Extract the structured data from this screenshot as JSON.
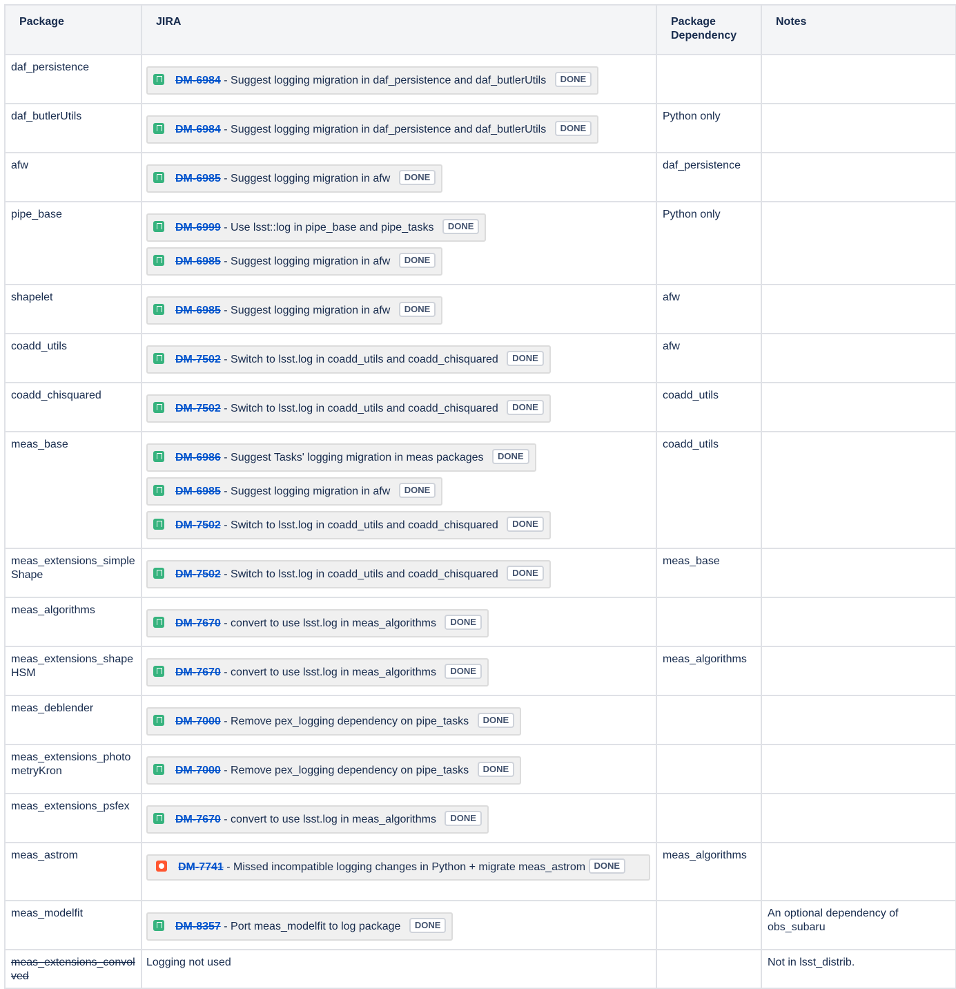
{
  "headers": {
    "package": "Package",
    "jira": "JIRA",
    "dependency": "Package Dependency",
    "notes": "Notes"
  },
  "rows": [
    {
      "package": "daf_persistence",
      "issues": [
        {
          "key": "DM-6984",
          "summary": "Suggest logging migration in daf_persistence and daf_butlerUtils",
          "status": "DONE",
          "type": "story"
        }
      ],
      "dependency": "",
      "notes": ""
    },
    {
      "package": "daf_butlerUtils",
      "issues": [
        {
          "key": "DM-6984",
          "summary": "Suggest logging migration in daf_persistence and daf_butlerUtils",
          "status": "DONE",
          "type": "story"
        }
      ],
      "dependency": "Python only",
      "notes": ""
    },
    {
      "package": "afw",
      "issues": [
        {
          "key": "DM-6985",
          "summary": "Suggest logging migration in afw",
          "status": "DONE",
          "type": "story"
        }
      ],
      "dependency": "daf_persistence",
      "notes": ""
    },
    {
      "package": "pipe_base",
      "issues": [
        {
          "key": "DM-6999",
          "summary": "Use lsst::log in pipe_base and pipe_tasks",
          "status": "DONE",
          "type": "story"
        },
        {
          "key": "DM-6985",
          "summary": "Suggest logging migration in afw",
          "status": "DONE",
          "type": "story"
        }
      ],
      "dependency": "Python only",
      "notes": ""
    },
    {
      "package": "shapelet",
      "issues": [
        {
          "key": "DM-6985",
          "summary": "Suggest logging migration in afw",
          "status": "DONE",
          "type": "story"
        }
      ],
      "dependency": "afw",
      "notes": ""
    },
    {
      "package": "coadd_utils",
      "issues": [
        {
          "key": "DM-7502",
          "summary": "Switch to lsst.log in coadd_utils and coadd_chisquared",
          "status": "DONE",
          "type": "story"
        }
      ],
      "dependency": "afw",
      "notes": ""
    },
    {
      "package": "coadd_chisquared",
      "issues": [
        {
          "key": "DM-7502",
          "summary": "Switch to lsst.log in coadd_utils and coadd_chisquared",
          "status": "DONE",
          "type": "story"
        }
      ],
      "dependency": "coadd_utils",
      "notes": ""
    },
    {
      "package": "meas_base",
      "issues": [
        {
          "key": "DM-6986",
          "summary": "Suggest Tasks' logging migration in meas packages",
          "status": "DONE",
          "type": "story"
        },
        {
          "key": "DM-6985",
          "summary": "Suggest logging migration in afw",
          "status": "DONE",
          "type": "story"
        },
        {
          "key": "DM-7502",
          "summary": "Switch to lsst.log in coadd_utils and coadd_chisquared",
          "status": "DONE",
          "type": "story"
        }
      ],
      "dependency": "coadd_utils",
      "notes": ""
    },
    {
      "package": "meas_extensions_simpleShape",
      "issues": [
        {
          "key": "DM-7502",
          "summary": "Switch to lsst.log in coadd_utils and coadd_chisquared",
          "status": "DONE",
          "type": "story"
        }
      ],
      "dependency": "meas_base",
      "notes": ""
    },
    {
      "package": "meas_algorithms",
      "issues": [
        {
          "key": "DM-7670",
          "summary": "convert to use lsst.log in meas_algorithms",
          "status": "DONE",
          "type": "story"
        }
      ],
      "dependency": "",
      "notes": ""
    },
    {
      "package": "meas_extensions_shapeHSM",
      "issues": [
        {
          "key": "DM-7670",
          "summary": "convert to use lsst.log in meas_algorithms",
          "status": "DONE",
          "type": "story"
        }
      ],
      "dependency": "meas_algorithms",
      "notes": ""
    },
    {
      "package": "meas_deblender",
      "issues": [
        {
          "key": "DM-7000",
          "summary": "Remove pex_logging dependency on pipe_tasks",
          "status": "DONE",
          "type": "story"
        }
      ],
      "dependency": "",
      "notes": ""
    },
    {
      "package": "meas_extensions_photometryKron",
      "issues": [
        {
          "key": "DM-7000",
          "summary": "Remove pex_logging dependency on pipe_tasks",
          "status": "DONE",
          "type": "story"
        }
      ],
      "dependency": "",
      "notes": ""
    },
    {
      "package": "meas_extensions_psfex",
      "issues": [
        {
          "key": "DM-7670",
          "summary": "convert to use lsst.log in meas_algorithms",
          "status": "DONE",
          "type": "story"
        }
      ],
      "dependency": "",
      "notes": ""
    },
    {
      "package": "meas_astrom",
      "issues": [
        {
          "key": "DM-7741",
          "summary": "Missed incompatible logging changes in Python + migrate meas_astrom",
          "status": "DONE",
          "type": "bug"
        }
      ],
      "dependency": "meas_algorithms",
      "notes": ""
    },
    {
      "package": "meas_modelfit",
      "issues": [
        {
          "key": "DM-8357",
          "summary": "Port meas_modelfit to log package",
          "status": "DONE",
          "type": "story"
        }
      ],
      "dependency": "",
      "notes": "An optional dependency of obs_subaru"
    },
    {
      "package": "meas_extensions_convolved",
      "struck": true,
      "jira_text": "Logging not used",
      "issues": [],
      "dependency": "",
      "notes": "Not in lsst_distrib."
    }
  ]
}
